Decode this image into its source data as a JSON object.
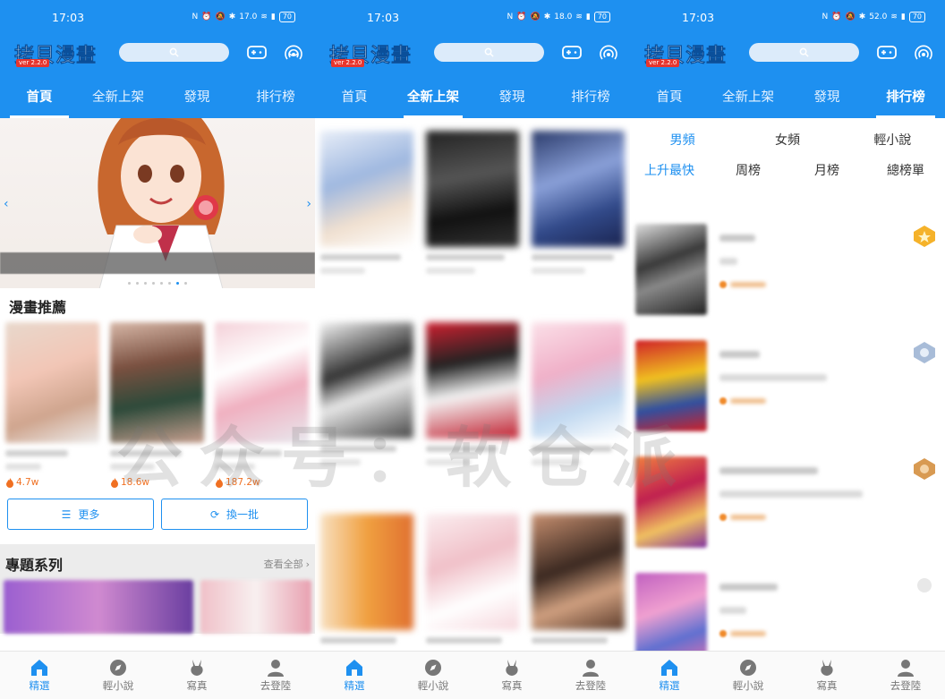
{
  "status": {
    "time": "17:03",
    "net_speed_1": "17.0",
    "net_speed_2": "18.0",
    "net_speed_3": "52.0",
    "battery": "70"
  },
  "app": {
    "name": "拷貝漫畫",
    "version": "ver 2.2.0"
  },
  "tabs": [
    "首頁",
    "全新上架",
    "發現",
    "排行榜"
  ],
  "home": {
    "recommend_title": "漫畫推薦",
    "recommend_heat": [
      "4.7w",
      "18.6w",
      "187.2w"
    ],
    "more_label": "更多",
    "refresh_label": "換一批",
    "topic_title": "專題系列",
    "topic_more": "查看全部"
  },
  "ranking": {
    "channels": [
      "男頻",
      "女頻",
      "輕小說"
    ],
    "periods": [
      "上升最快",
      "周榜",
      "月榜",
      "總榜單"
    ]
  },
  "bottom_nav": [
    "精選",
    "輕小說",
    "寫真",
    "去登陸"
  ],
  "watermark": "公众号：软仓派",
  "colors": {
    "primary": "#1e90f0",
    "heat": "#f07022"
  }
}
